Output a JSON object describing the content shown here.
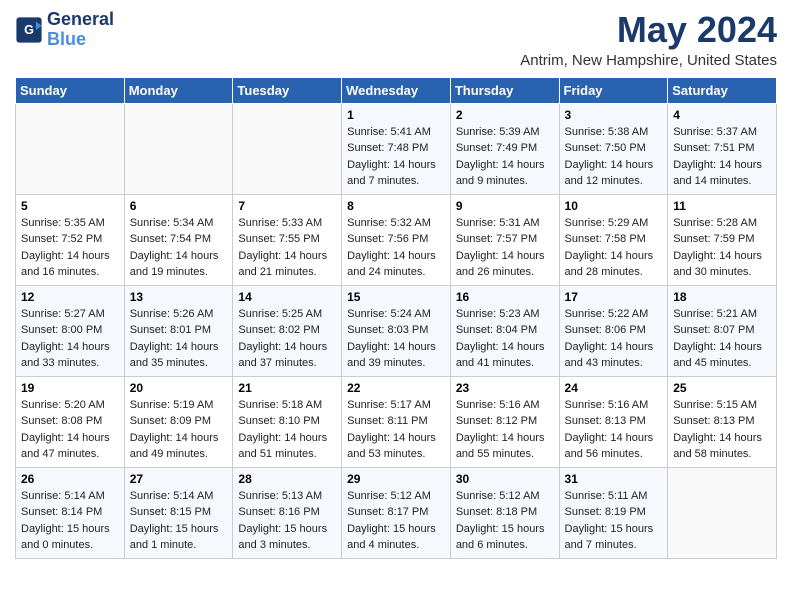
{
  "header": {
    "logo_line1": "General",
    "logo_line2": "Blue",
    "title": "May 2024",
    "subtitle": "Antrim, New Hampshire, United States"
  },
  "calendar": {
    "weekdays": [
      "Sunday",
      "Monday",
      "Tuesday",
      "Wednesday",
      "Thursday",
      "Friday",
      "Saturday"
    ],
    "weeks": [
      [
        {
          "day": "",
          "sunrise": "",
          "sunset": "",
          "daylight": ""
        },
        {
          "day": "",
          "sunrise": "",
          "sunset": "",
          "daylight": ""
        },
        {
          "day": "",
          "sunrise": "",
          "sunset": "",
          "daylight": ""
        },
        {
          "day": "1",
          "sunrise": "Sunrise: 5:41 AM",
          "sunset": "Sunset: 7:48 PM",
          "daylight": "Daylight: 14 hours and 7 minutes."
        },
        {
          "day": "2",
          "sunrise": "Sunrise: 5:39 AM",
          "sunset": "Sunset: 7:49 PM",
          "daylight": "Daylight: 14 hours and 9 minutes."
        },
        {
          "day": "3",
          "sunrise": "Sunrise: 5:38 AM",
          "sunset": "Sunset: 7:50 PM",
          "daylight": "Daylight: 14 hours and 12 minutes."
        },
        {
          "day": "4",
          "sunrise": "Sunrise: 5:37 AM",
          "sunset": "Sunset: 7:51 PM",
          "daylight": "Daylight: 14 hours and 14 minutes."
        }
      ],
      [
        {
          "day": "5",
          "sunrise": "Sunrise: 5:35 AM",
          "sunset": "Sunset: 7:52 PM",
          "daylight": "Daylight: 14 hours and 16 minutes."
        },
        {
          "day": "6",
          "sunrise": "Sunrise: 5:34 AM",
          "sunset": "Sunset: 7:54 PM",
          "daylight": "Daylight: 14 hours and 19 minutes."
        },
        {
          "day": "7",
          "sunrise": "Sunrise: 5:33 AM",
          "sunset": "Sunset: 7:55 PM",
          "daylight": "Daylight: 14 hours and 21 minutes."
        },
        {
          "day": "8",
          "sunrise": "Sunrise: 5:32 AM",
          "sunset": "Sunset: 7:56 PM",
          "daylight": "Daylight: 14 hours and 24 minutes."
        },
        {
          "day": "9",
          "sunrise": "Sunrise: 5:31 AM",
          "sunset": "Sunset: 7:57 PM",
          "daylight": "Daylight: 14 hours and 26 minutes."
        },
        {
          "day": "10",
          "sunrise": "Sunrise: 5:29 AM",
          "sunset": "Sunset: 7:58 PM",
          "daylight": "Daylight: 14 hours and 28 minutes."
        },
        {
          "day": "11",
          "sunrise": "Sunrise: 5:28 AM",
          "sunset": "Sunset: 7:59 PM",
          "daylight": "Daylight: 14 hours and 30 minutes."
        }
      ],
      [
        {
          "day": "12",
          "sunrise": "Sunrise: 5:27 AM",
          "sunset": "Sunset: 8:00 PM",
          "daylight": "Daylight: 14 hours and 33 minutes."
        },
        {
          "day": "13",
          "sunrise": "Sunrise: 5:26 AM",
          "sunset": "Sunset: 8:01 PM",
          "daylight": "Daylight: 14 hours and 35 minutes."
        },
        {
          "day": "14",
          "sunrise": "Sunrise: 5:25 AM",
          "sunset": "Sunset: 8:02 PM",
          "daylight": "Daylight: 14 hours and 37 minutes."
        },
        {
          "day": "15",
          "sunrise": "Sunrise: 5:24 AM",
          "sunset": "Sunset: 8:03 PM",
          "daylight": "Daylight: 14 hours and 39 minutes."
        },
        {
          "day": "16",
          "sunrise": "Sunrise: 5:23 AM",
          "sunset": "Sunset: 8:04 PM",
          "daylight": "Daylight: 14 hours and 41 minutes."
        },
        {
          "day": "17",
          "sunrise": "Sunrise: 5:22 AM",
          "sunset": "Sunset: 8:06 PM",
          "daylight": "Daylight: 14 hours and 43 minutes."
        },
        {
          "day": "18",
          "sunrise": "Sunrise: 5:21 AM",
          "sunset": "Sunset: 8:07 PM",
          "daylight": "Daylight: 14 hours and 45 minutes."
        }
      ],
      [
        {
          "day": "19",
          "sunrise": "Sunrise: 5:20 AM",
          "sunset": "Sunset: 8:08 PM",
          "daylight": "Daylight: 14 hours and 47 minutes."
        },
        {
          "day": "20",
          "sunrise": "Sunrise: 5:19 AM",
          "sunset": "Sunset: 8:09 PM",
          "daylight": "Daylight: 14 hours and 49 minutes."
        },
        {
          "day": "21",
          "sunrise": "Sunrise: 5:18 AM",
          "sunset": "Sunset: 8:10 PM",
          "daylight": "Daylight: 14 hours and 51 minutes."
        },
        {
          "day": "22",
          "sunrise": "Sunrise: 5:17 AM",
          "sunset": "Sunset: 8:11 PM",
          "daylight": "Daylight: 14 hours and 53 minutes."
        },
        {
          "day": "23",
          "sunrise": "Sunrise: 5:16 AM",
          "sunset": "Sunset: 8:12 PM",
          "daylight": "Daylight: 14 hours and 55 minutes."
        },
        {
          "day": "24",
          "sunrise": "Sunrise: 5:16 AM",
          "sunset": "Sunset: 8:13 PM",
          "daylight": "Daylight: 14 hours and 56 minutes."
        },
        {
          "day": "25",
          "sunrise": "Sunrise: 5:15 AM",
          "sunset": "Sunset: 8:13 PM",
          "daylight": "Daylight: 14 hours and 58 minutes."
        }
      ],
      [
        {
          "day": "26",
          "sunrise": "Sunrise: 5:14 AM",
          "sunset": "Sunset: 8:14 PM",
          "daylight": "Daylight: 15 hours and 0 minutes."
        },
        {
          "day": "27",
          "sunrise": "Sunrise: 5:14 AM",
          "sunset": "Sunset: 8:15 PM",
          "daylight": "Daylight: 15 hours and 1 minute."
        },
        {
          "day": "28",
          "sunrise": "Sunrise: 5:13 AM",
          "sunset": "Sunset: 8:16 PM",
          "daylight": "Daylight: 15 hours and 3 minutes."
        },
        {
          "day": "29",
          "sunrise": "Sunrise: 5:12 AM",
          "sunset": "Sunset: 8:17 PM",
          "daylight": "Daylight: 15 hours and 4 minutes."
        },
        {
          "day": "30",
          "sunrise": "Sunrise: 5:12 AM",
          "sunset": "Sunset: 8:18 PM",
          "daylight": "Daylight: 15 hours and 6 minutes."
        },
        {
          "day": "31",
          "sunrise": "Sunrise: 5:11 AM",
          "sunset": "Sunset: 8:19 PM",
          "daylight": "Daylight: 15 hours and 7 minutes."
        },
        {
          "day": "",
          "sunrise": "",
          "sunset": "",
          "daylight": ""
        }
      ]
    ]
  }
}
